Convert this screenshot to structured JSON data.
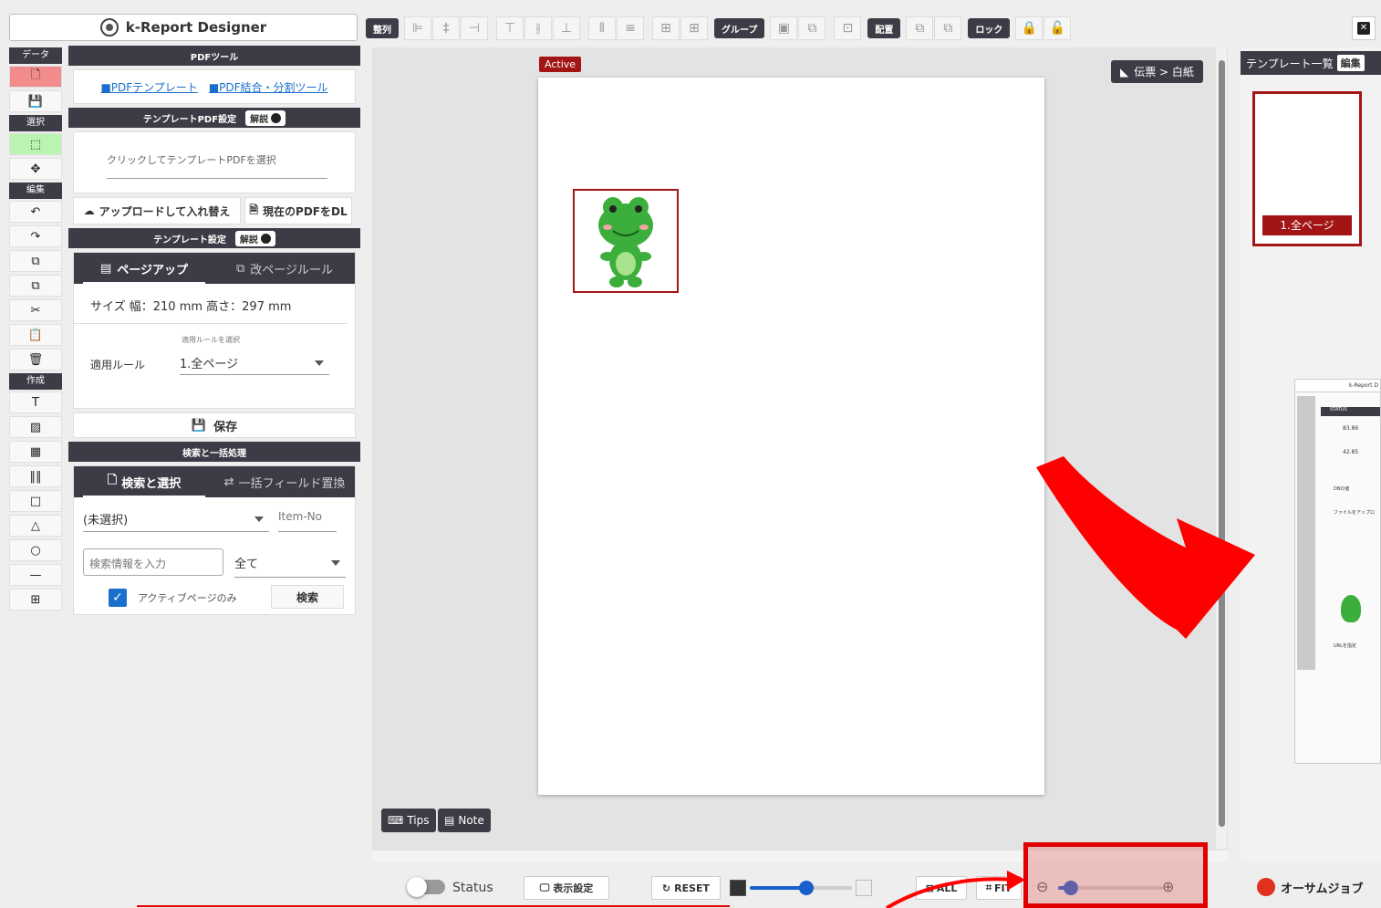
{
  "app": {
    "title": "k-Report Designer",
    "close_label": "✕"
  },
  "toolbar": {
    "align_label": "整列",
    "group_label": "グループ",
    "layout_label": "配置",
    "lock_label": "ロック"
  },
  "rail": {
    "cat_data": "データ",
    "cat_select": "選択",
    "cat_edit": "編集",
    "cat_create": "作成"
  },
  "panel": {
    "pdf_tools_header": "PDFツール",
    "link_pdf_template": "■PDFテンプレート",
    "link_pdf_merge": "■PDF結合・分割ツール",
    "template_pdf_header": "テンプレートPDF設定",
    "help_label": "解説",
    "pdf_placeholder": "クリックしてテンプレートPDFを選択",
    "upload_button": "アップロードして入れ替え",
    "download_button": "現在のPDFをDL",
    "template_settings_header": "テンプレート設定",
    "tab_page_up": "ページアップ",
    "tab_page_rule": "改ページルール",
    "size_text": "サイズ  幅：210 mm    高さ：297 mm",
    "rule_caption": "適用ルールを選択",
    "rule_label": "適用ルール",
    "rule_value": "1.全ページ",
    "save_button": "保存",
    "search_header": "検索と一括処理",
    "tab_search": "検索と選択",
    "tab_replace": "一括フィールド置換",
    "field_select_value": "(未選択)",
    "item_no_placeholder": "Item-No",
    "search_placeholder": "検索情報を入力",
    "scope_value": "全て",
    "active_only_label": "アクティブページのみ",
    "search_button": "検索"
  },
  "canvas": {
    "active_badge": "Active",
    "breadcrumb": "伝票 > 白紙",
    "tips_label": "Tips",
    "note_label": "Note"
  },
  "right": {
    "header": "テンプレート一覧",
    "edit_label": "編集",
    "page_label": "1.全ページ"
  },
  "bottom": {
    "status_label": "Status",
    "display_settings": "表示設定",
    "reset_label": "RESET",
    "all_label": "ALL",
    "fit_label": "FIT",
    "brand": "オーサムジョブ",
    "status_on": false,
    "opacity_level": 0.55,
    "zoom_level": 0.12
  },
  "mini": {
    "title": "k-Report D",
    "status": "STATUS",
    "v1": "83.86",
    "v2": "42.85",
    "db_label": "DBの値",
    "upload": "ファイルをアップロ",
    "url_label": "URLを指定"
  },
  "colors": {
    "accent_red": "#a31515",
    "dark": "#3c3c46",
    "blue": "#1a5fcc"
  }
}
